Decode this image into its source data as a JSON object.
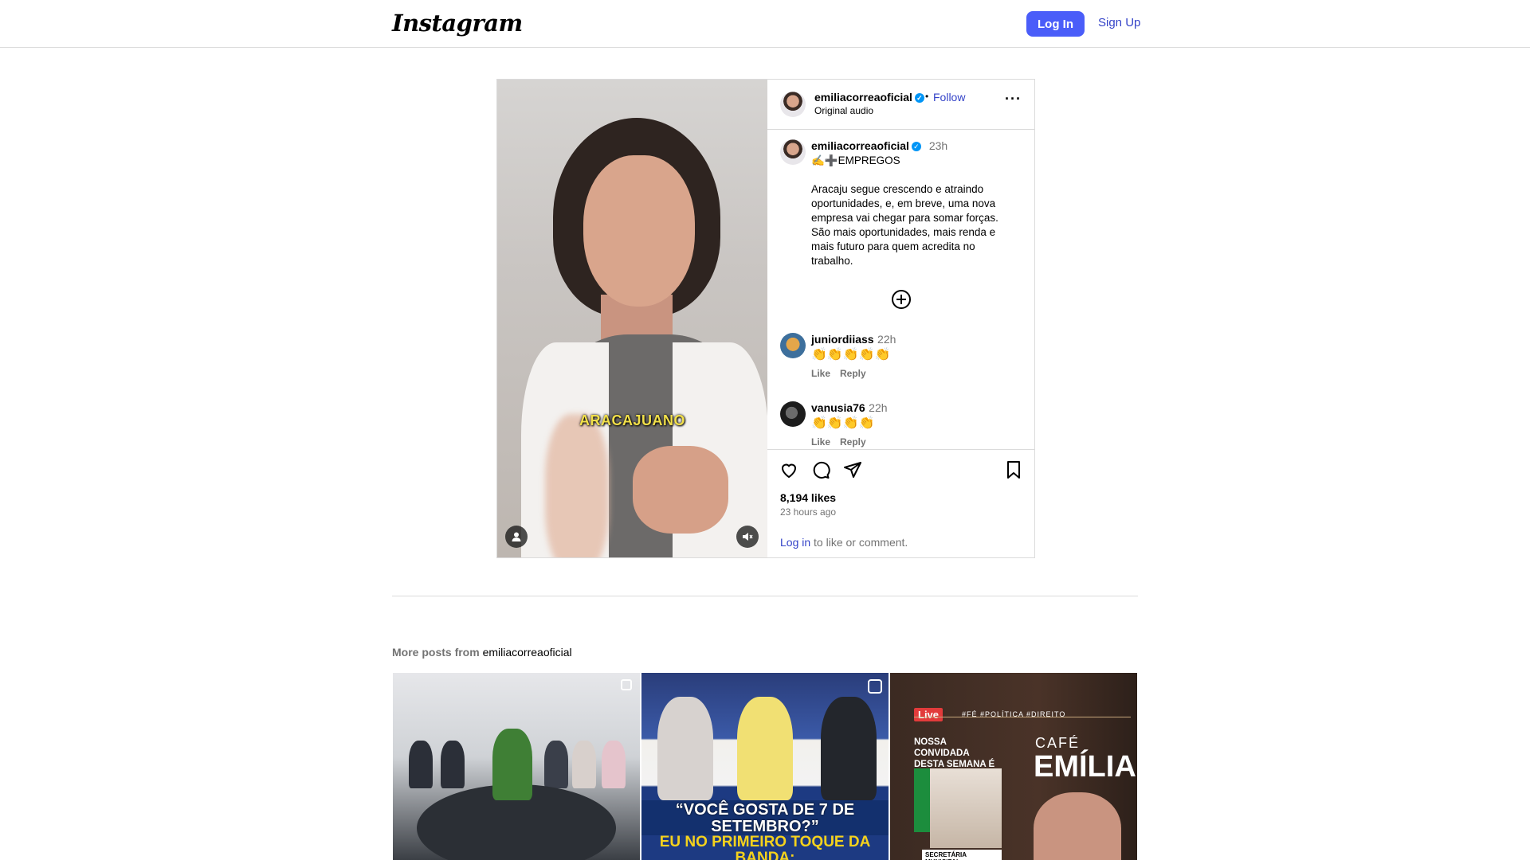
{
  "header": {
    "logo": "Instagram",
    "login_label": "Log In",
    "signup_label": "Sign Up"
  },
  "post": {
    "media": {
      "overlay_text": "ARACAJUANO",
      "user_tag_icon": "person-icon",
      "mute_icon": "muted-speaker-icon"
    },
    "author": {
      "username": "emiliacorreaoficial",
      "verified_icon": "verified-badge-icon",
      "follow_label": "Follow",
      "separator": "•",
      "audio": "Original audio",
      "more_icon": "more-options-icon",
      "more_glyph": "···"
    },
    "caption": {
      "username": "emiliacorreaoficial",
      "time": "23h",
      "first_line": "✍️➕EMPREGOS",
      "body": "Aracaju segue crescendo e atraindo oportunidades, e, em breve, uma nova empresa vai chegar para somar forças. São mais oportunidades, mais renda e mais futuro para quem acredita no trabalho."
    },
    "load_more_icon": "plus-circle-icon",
    "comments": [
      {
        "username": "juniordiiass",
        "time": "22h",
        "text": "👏👏👏👏👏",
        "like_label": "Like",
        "reply_label": "Reply"
      },
      {
        "username": "vanusia76",
        "time": "22h",
        "text": "👏👏👏👏",
        "like_label": "Like",
        "reply_label": "Reply"
      }
    ],
    "actions": {
      "like_icon": "heart-icon",
      "comment_icon": "comment-icon",
      "share_icon": "send-icon",
      "save_icon": "bookmark-icon"
    },
    "likes": "8,194 likes",
    "posted_ago": "23 hours ago",
    "login_link": "Log in",
    "login_rest": " to like or comment."
  },
  "more_posts": {
    "label": "More posts from ",
    "account": "emiliacorreaoficial",
    "thumbs": [
      {
        "kind": "carousel",
        "icon": "carousel-icon"
      },
      {
        "kind": "reel",
        "icon": "reel-icon",
        "quote": "“VOCÊ GOSTA DE 7 DE SETEMBRO?”",
        "quote2": "EU NO PRIMEIRO TOQUE DA BANDA:"
      },
      {
        "kind": "image",
        "live": "Live",
        "tags": "#FÉ #POLÍTICA #DIREITO",
        "convidada": "NOSSA CONVIDADA DESTA SEMANA É A",
        "cafe": "CAFÉ",
        "emilia": "EMÍLIA",
        "secretaria": "SECRETÁRIA MUNICIPAL"
      }
    ]
  }
}
